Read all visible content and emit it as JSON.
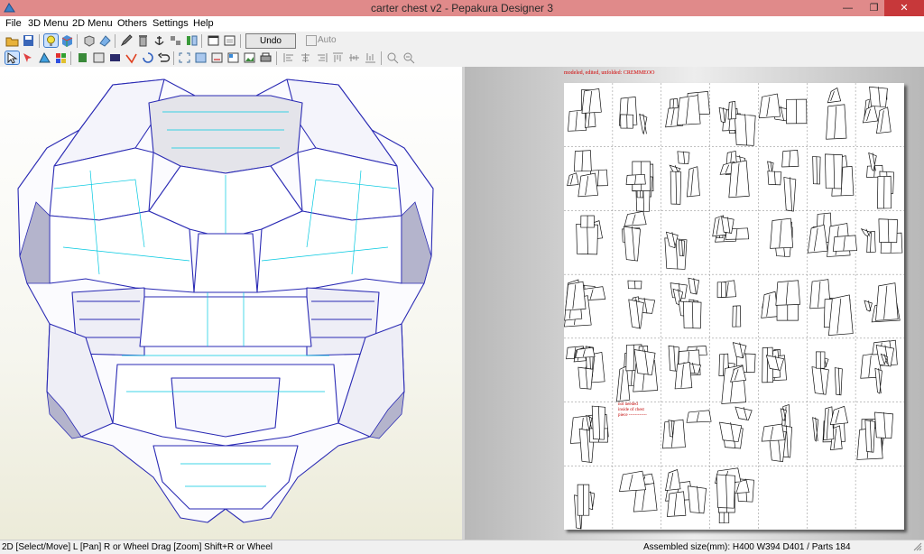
{
  "window": {
    "title": "carter chest v2 - Pepakura Designer 3"
  },
  "menu": [
    "File",
    "3D Menu",
    "2D Menu",
    "Others",
    "Settings",
    "Help"
  ],
  "toolbar": {
    "undo_unfold": "Undo Unfold",
    "auto_label": "Auto"
  },
  "sheet": {
    "header_note": "modeled, edited, unfolded: CREMMEOO",
    "annotation": [
      "not needed",
      "inside of chest",
      "piece ------------"
    ]
  },
  "status": {
    "hint": "2D [Select/Move] L [Pan] R or Wheel Drag [Zoom] Shift+R or Wheel",
    "assembled": "Assembled size(mm): H400 W394 D401 / Parts 184"
  },
  "colors": {
    "titlebar": "#e08a8a",
    "edge_blue": "#2a2ab4",
    "fold_cyan": "#00c8e0"
  }
}
